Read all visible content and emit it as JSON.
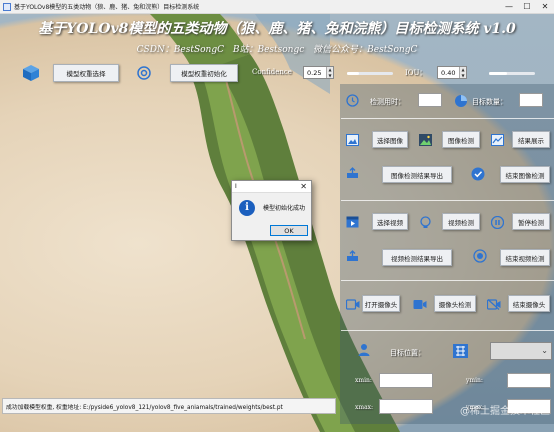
{
  "window": {
    "title": "基于YOLOv8模型的五类动物（狼、鹿、猪、兔和浣熊）目标检测系统",
    "minimize": "—",
    "maximize": "☐",
    "close": "✕"
  },
  "header": {
    "title": "基于YOLOv8模型的五类动物（狼、鹿、猪、兔和浣熊）目标检测系统 v1.0",
    "subtitle": "CSDN：BestSongC   B站：Bestsongc   微信公众号：BestSongC"
  },
  "toolbar": {
    "select_weights": "模型权重选择",
    "init_weights": "模型权重初始化",
    "confidence_label": "Confidence",
    "confidence_value": "0.25",
    "confidence_level": 0.25,
    "iou_label": "IOU：",
    "iou_value": "0.40",
    "iou_level": 0.4
  },
  "panel": {
    "time_label": "检测用时：",
    "count_label": "目标数量：",
    "select_image": "选择图像",
    "detect_image": "图像检测",
    "show_result": "结果展示",
    "export_image_result": "图像检测结果导出",
    "stop_image_detect": "结束图像检测",
    "select_video": "选择视频",
    "detect_video": "视频检测",
    "pause_detect": "暂停检测",
    "export_video_result": "视频检测结果导出",
    "stop_video_detect": "结束视频检测",
    "open_camera": "打开摄像头",
    "camera_detect": "摄像头检测",
    "close_camera": "结束摄像头",
    "target_pos_label": "目标位置：",
    "xmin": "xmin:",
    "ymin": "ymin:",
    "xmax": "xmax:",
    "ymax": "ymax:"
  },
  "status": {
    "message": "成功加载模型权重, 权重地址: E:/pyside6_yolov8_121/yolov8_five_aniamals/trained/weights/best.pt"
  },
  "dialog": {
    "title": "I",
    "close": "✕",
    "message": "模型初始化成功",
    "ok": "OK"
  },
  "watermark": "@稀土掘金技术社区",
  "colors": {
    "accent": "#1b5fbe",
    "icon_blue": "#2f74d0"
  }
}
